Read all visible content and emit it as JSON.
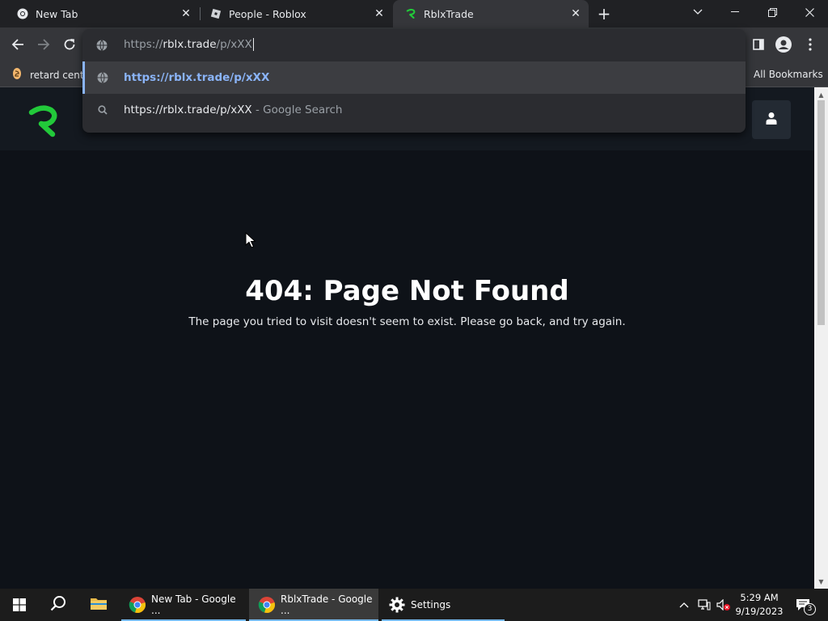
{
  "tabs": [
    {
      "title": "New Tab",
      "icon": "chrome-icon",
      "active": false
    },
    {
      "title": "People - Roblox",
      "icon": "roblox-icon",
      "active": false
    },
    {
      "title": "RblxTrade",
      "icon": "rblxtrade-logo-icon",
      "active": true
    }
  ],
  "omnibox": {
    "value_prefix": "https://",
    "value_host": "rblx.trade",
    "value_path": "/p/xXX",
    "suggestions": [
      {
        "url": "https://rblx.trade/p/xXX",
        "icon": "globe-icon"
      },
      {
        "query": "https://rblx.trade/p/xXX",
        "suffix": " - Google Search",
        "icon": "search-icon"
      }
    ]
  },
  "bookmarks": {
    "first": "retard centra",
    "all": "All Bookmarks"
  },
  "page": {
    "error_title": "404: Page Not Found",
    "error_desc": "The page you tried to visit doesn't seem to exist. Please go back, and try again."
  },
  "taskbar": {
    "apps": [
      {
        "label": "New Tab - Google ...",
        "icon": "chrome-icon"
      },
      {
        "label": "RblxTrade - Google ...",
        "icon": "chrome-icon",
        "active": true
      },
      {
        "label": "Settings",
        "icon": "gear-icon"
      }
    ],
    "time": "5:29 AM",
    "date": "9/19/2023",
    "notifications": "3"
  },
  "colors": {
    "brand_green": "#22c93a",
    "link_blue": "#8ab4f8",
    "page_bg": "#0e1218"
  }
}
